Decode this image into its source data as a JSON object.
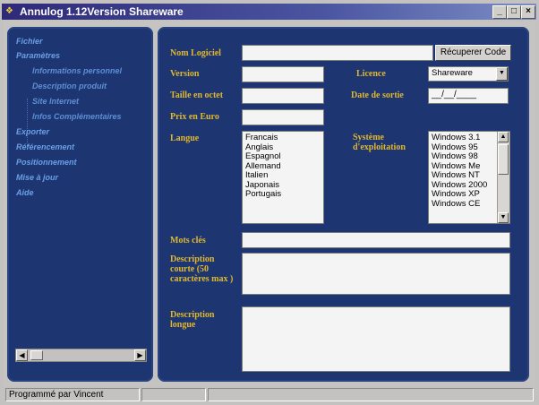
{
  "window": {
    "title": "Annulog 1.12Version Shareware",
    "minimize": "_",
    "maximize": "□",
    "close": "×"
  },
  "sidebar": {
    "items": [
      {
        "label": "Fichier"
      },
      {
        "label": "Paramètres"
      },
      {
        "label": "Informations personnel"
      },
      {
        "label": "Description produit"
      },
      {
        "label": "Site Internet"
      },
      {
        "label": "Infos Complémentaires"
      },
      {
        "label": "Exporter"
      },
      {
        "label": "Référencement"
      },
      {
        "label": "Positionnement"
      },
      {
        "label": "Mise à jour"
      },
      {
        "label": "Aide"
      }
    ]
  },
  "form": {
    "nom_logiciel": {
      "label": "Nom Logiciel",
      "value": ""
    },
    "recuperer_code": "Récuperer Code",
    "version": {
      "label": "Version",
      "value": ""
    },
    "licence": {
      "label": "Licence",
      "value": "Shareware"
    },
    "taille": {
      "label": "Taille en octet",
      "value": ""
    },
    "date_sortie": {
      "label": "Date de sortie",
      "value": "__/__/____"
    },
    "prix": {
      "label": "Prix en Euro",
      "value": ""
    },
    "langue": {
      "label": "Langue",
      "options": [
        "Francais",
        "Anglais",
        "Espagnol",
        "Allemand",
        "Italien",
        "Japonais",
        "Portugais"
      ]
    },
    "systeme": {
      "label": "Système d'exploitation",
      "options": [
        "Windows 3.1",
        "Windows 95",
        "Windows 98",
        "Windows Me",
        "Windows NT",
        "Windows 2000",
        "Windows XP",
        "Windows CE"
      ]
    },
    "mots_cles": {
      "label": "Mots clés",
      "value": ""
    },
    "description_courte": {
      "label": "Description courte (50 caractères max )",
      "value": ""
    },
    "description_longue": {
      "label": "Description longue",
      "value": ""
    }
  },
  "status": {
    "text": "Programmé par Vincent"
  }
}
